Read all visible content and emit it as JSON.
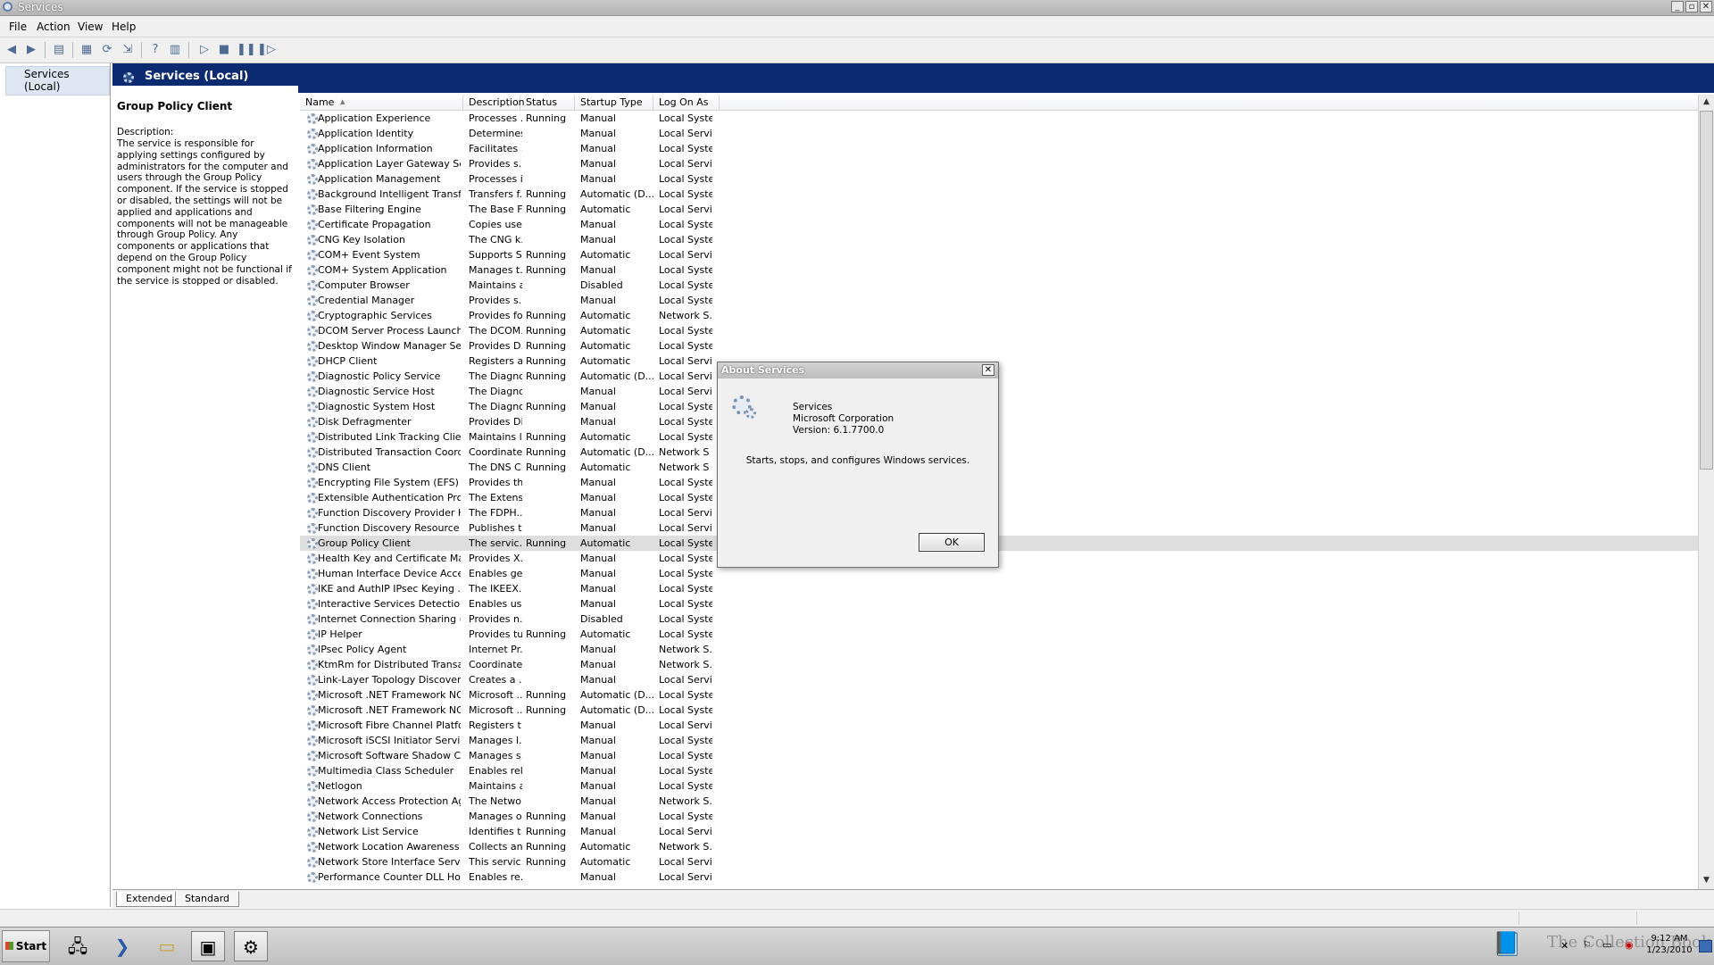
{
  "window": {
    "title": "Services"
  },
  "menu": [
    "File",
    "Action",
    "View",
    "Help"
  ],
  "tree": {
    "root": "Services (Local)"
  },
  "header": {
    "title": "Services (Local)"
  },
  "description_pane": {
    "service_name": "Group Policy Client",
    "label": "Description:",
    "text": "The service is responsible for applying settings configured by administrators for the computer and users through the Group Policy component. If the service is stopped or disabled, the settings will not be applied and applications and components will not be manageable through Group Policy. Any components or applications that depend on the Group Policy component might not be functional if the service is stopped or disabled."
  },
  "columns": [
    "Name",
    "Description",
    "Status",
    "Startup Type",
    "Log On As"
  ],
  "sort": {
    "column": "Name",
    "direction": "ascending"
  },
  "selected_row": "Group Policy Client",
  "rows": [
    {
      "name": "Application Experience",
      "description": "Processes ...",
      "status": "Running",
      "startup": "Manual",
      "logon": "Local System"
    },
    {
      "name": "Application Identity",
      "description": "Determines...",
      "status": "",
      "startup": "Manual",
      "logon": "Local Service"
    },
    {
      "name": "Application Information",
      "description": "Facilitates ...",
      "status": "",
      "startup": "Manual",
      "logon": "Local System"
    },
    {
      "name": "Application Layer Gateway Se...",
      "description": "Provides s...",
      "status": "",
      "startup": "Manual",
      "logon": "Local Service"
    },
    {
      "name": "Application Management",
      "description": "Processes i...",
      "status": "",
      "startup": "Manual",
      "logon": "Local System"
    },
    {
      "name": "Background Intelligent Transf...",
      "description": "Transfers f...",
      "status": "Running",
      "startup": "Automatic (D...",
      "logon": "Local System"
    },
    {
      "name": "Base Filtering Engine",
      "description": "The Base F...",
      "status": "Running",
      "startup": "Automatic",
      "logon": "Local Service"
    },
    {
      "name": "Certificate Propagation",
      "description": "Copies use...",
      "status": "",
      "startup": "Manual",
      "logon": "Local System"
    },
    {
      "name": "CNG Key Isolation",
      "description": "The CNG k...",
      "status": "",
      "startup": "Manual",
      "logon": "Local System"
    },
    {
      "name": "COM+ Event System",
      "description": "Supports S...",
      "status": "Running",
      "startup": "Automatic",
      "logon": "Local Service"
    },
    {
      "name": "COM+ System Application",
      "description": "Manages t...",
      "status": "Running",
      "startup": "Manual",
      "logon": "Local System"
    },
    {
      "name": "Computer Browser",
      "description": "Maintains a...",
      "status": "",
      "startup": "Disabled",
      "logon": "Local System"
    },
    {
      "name": "Credential Manager",
      "description": "Provides s...",
      "status": "",
      "startup": "Manual",
      "logon": "Local System"
    },
    {
      "name": "Cryptographic Services",
      "description": "Provides fo...",
      "status": "Running",
      "startup": "Automatic",
      "logon": "Network S..."
    },
    {
      "name": "DCOM Server Process Launcher",
      "description": "The DCOM...",
      "status": "Running",
      "startup": "Automatic",
      "logon": "Local System"
    },
    {
      "name": "Desktop Window Manager Se...",
      "description": "Provides D...",
      "status": "Running",
      "startup": "Automatic",
      "logon": "Local System"
    },
    {
      "name": "DHCP Client",
      "description": "Registers a...",
      "status": "Running",
      "startup": "Automatic",
      "logon": "Local Servi"
    },
    {
      "name": "Diagnostic Policy Service",
      "description": "The Diagno...",
      "status": "Running",
      "startup": "Automatic (D...",
      "logon": "Local Servi"
    },
    {
      "name": "Diagnostic Service Host",
      "description": "The Diagno...",
      "status": "",
      "startup": "Manual",
      "logon": "Local Servi"
    },
    {
      "name": "Diagnostic System Host",
      "description": "The Diagno...",
      "status": "Running",
      "startup": "Manual",
      "logon": "Local Syste"
    },
    {
      "name": "Disk Defragmenter",
      "description": "Provides Di...",
      "status": "",
      "startup": "Manual",
      "logon": "Local Syste"
    },
    {
      "name": "Distributed Link Tracking Client",
      "description": "Maintains li...",
      "status": "Running",
      "startup": "Automatic",
      "logon": "Local Syste"
    },
    {
      "name": "Distributed Transaction Coord...",
      "description": "Coordinate...",
      "status": "Running",
      "startup": "Automatic (D...",
      "logon": "Network S"
    },
    {
      "name": "DNS Client",
      "description": "The DNS Cl...",
      "status": "Running",
      "startup": "Automatic",
      "logon": "Network S"
    },
    {
      "name": "Encrypting File System (EFS)",
      "description": "Provides th...",
      "status": "",
      "startup": "Manual",
      "logon": "Local Syste"
    },
    {
      "name": "Extensible Authentication Pro...",
      "description": "The Extens...",
      "status": "",
      "startup": "Manual",
      "logon": "Local Syste"
    },
    {
      "name": "Function Discovery Provider H...",
      "description": "The FDPH...",
      "status": "",
      "startup": "Manual",
      "logon": "Local Servi"
    },
    {
      "name": "Function Discovery Resource ...",
      "description": "Publishes t...",
      "status": "",
      "startup": "Manual",
      "logon": "Local Servi"
    },
    {
      "name": "Group Policy Client",
      "description": "The servic...",
      "status": "Running",
      "startup": "Automatic",
      "logon": "Local Syste"
    },
    {
      "name": "Health Key and Certificate Ma...",
      "description": "Provides X...",
      "status": "",
      "startup": "Manual",
      "logon": "Local Syste"
    },
    {
      "name": "Human Interface Device Access",
      "description": "Enables ge...",
      "status": "",
      "startup": "Manual",
      "logon": "Local System"
    },
    {
      "name": "IKE and AuthIP IPsec Keying ...",
      "description": "The IKEEX...",
      "status": "",
      "startup": "Manual",
      "logon": "Local System"
    },
    {
      "name": "Interactive Services Detection",
      "description": "Enables us...",
      "status": "",
      "startup": "Manual",
      "logon": "Local System"
    },
    {
      "name": "Internet Connection Sharing (...",
      "description": "Provides n...",
      "status": "",
      "startup": "Disabled",
      "logon": "Local System"
    },
    {
      "name": "IP Helper",
      "description": "Provides tu...",
      "status": "Running",
      "startup": "Automatic",
      "logon": "Local System"
    },
    {
      "name": "IPsec Policy Agent",
      "description": "Internet Pr...",
      "status": "",
      "startup": "Manual",
      "logon": "Network S..."
    },
    {
      "name": "KtmRm for Distributed Transa...",
      "description": "Coordinate...",
      "status": "",
      "startup": "Manual",
      "logon": "Network S..."
    },
    {
      "name": "Link-Layer Topology Discover...",
      "description": "Creates a ...",
      "status": "",
      "startup": "Manual",
      "logon": "Local Service"
    },
    {
      "name": "Microsoft .NET Framework NG...",
      "description": "Microsoft ....",
      "status": "Running",
      "startup": "Automatic (D...",
      "logon": "Local System"
    },
    {
      "name": "Microsoft .NET Framework NG...",
      "description": "Microsoft ....",
      "status": "Running",
      "startup": "Automatic (D...",
      "logon": "Local System"
    },
    {
      "name": "Microsoft Fibre Channel Platfo...",
      "description": "Registers t...",
      "status": "",
      "startup": "Manual",
      "logon": "Local Service"
    },
    {
      "name": "Microsoft iSCSI Initiator Service",
      "description": "Manages I...",
      "status": "",
      "startup": "Manual",
      "logon": "Local System"
    },
    {
      "name": "Microsoft Software Shadow C...",
      "description": "Manages s...",
      "status": "",
      "startup": "Manual",
      "logon": "Local System"
    },
    {
      "name": "Multimedia Class Scheduler",
      "description": "Enables rel...",
      "status": "",
      "startup": "Manual",
      "logon": "Local System"
    },
    {
      "name": "Netlogon",
      "description": "Maintains a...",
      "status": "",
      "startup": "Manual",
      "logon": "Local System"
    },
    {
      "name": "Network Access Protection Ag...",
      "description": "The Netwo...",
      "status": "",
      "startup": "Manual",
      "logon": "Network S..."
    },
    {
      "name": "Network Connections",
      "description": "Manages o...",
      "status": "Running",
      "startup": "Manual",
      "logon": "Local System"
    },
    {
      "name": "Network List Service",
      "description": "Identifies t...",
      "status": "Running",
      "startup": "Manual",
      "logon": "Local Service"
    },
    {
      "name": "Network Location Awareness",
      "description": "Collects an...",
      "status": "Running",
      "startup": "Automatic",
      "logon": "Network S..."
    },
    {
      "name": "Network Store Interface Service",
      "description": "This servic...",
      "status": "Running",
      "startup": "Automatic",
      "logon": "Local Service"
    },
    {
      "name": "Performance Counter DLL Host",
      "description": "Enables re...",
      "status": "",
      "startup": "Manual",
      "logon": "Local Service"
    }
  ],
  "tabs": [
    "Extended",
    "Standard"
  ],
  "active_tab": "Extended",
  "dialog": {
    "title": "About Services",
    "product": "Services",
    "company": "Microsoft Corporation",
    "version": "Version: 6.1.7700.0",
    "blurb": "Starts, stops, and configures Windows services.",
    "ok_label": "OK"
  },
  "taskbar": {
    "start_label": "Start",
    "clock_time": "9:12 AM",
    "clock_date": "1/23/2010",
    "watermark": "The Collection Book"
  },
  "colors": {
    "header_band": "#0b2a6f",
    "selected_row": "#dedede"
  }
}
